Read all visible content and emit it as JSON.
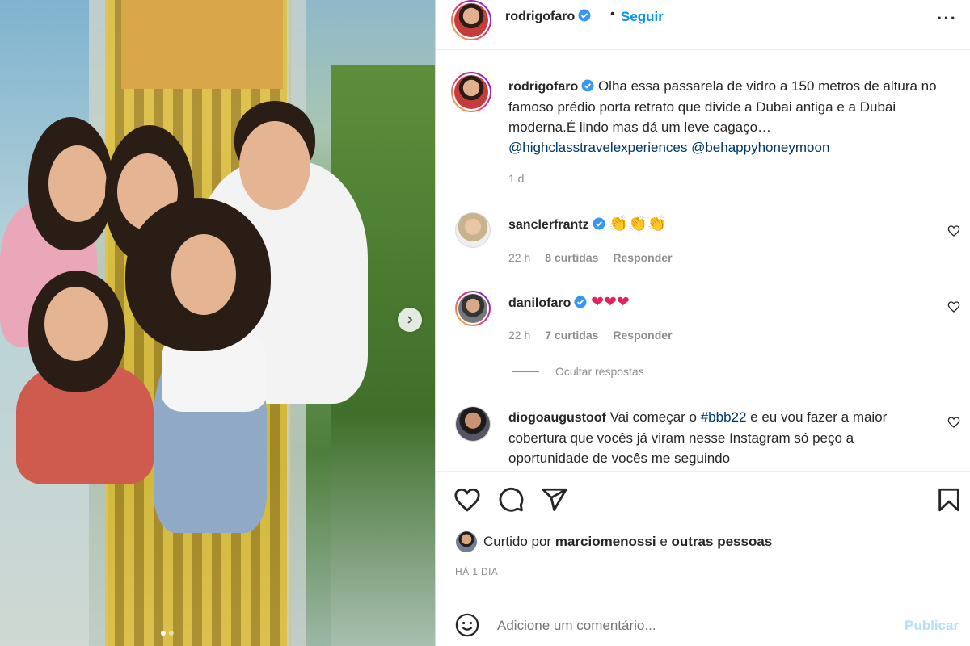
{
  "post": {
    "author": "rodrigofaro",
    "follow_label": "Seguir",
    "separator": "•",
    "more_label": "···",
    "photo_alt": "Foto da família na passarela de vidro",
    "carousel": {
      "current": 1,
      "total": 2
    }
  },
  "caption": {
    "author": "rodrigofaro",
    "text": "Olha essa passarela de vidro a 150 metros de altura no famoso prédio porta retrato que divide a Dubai antiga e a Dubai moderna.É lindo mas dá um leve cagaço…",
    "mentions": "@highclasstravelexperiences @behappyhoneymoon",
    "time": "1 d"
  },
  "comments": [
    {
      "author": "sanclerfrantz",
      "verified": true,
      "text": "👏👏👏",
      "time": "22 h",
      "likes": "8 curtidas",
      "reply": "Responder"
    },
    {
      "author": "danilofaro",
      "verified": true,
      "text": "❤❤❤",
      "time": "22 h",
      "likes": "7 curtidas",
      "reply": "Responder"
    },
    {
      "author": "diogoaugustoof",
      "verified": false,
      "text_pre": "Vai começar o ",
      "hashtag": "#bbb22",
      "text_post": "  e eu vou fazer a maior cobertura que vocês já viram nesse Instagram só peço a oportunidade de vocês me seguindo"
    }
  ],
  "hide_replies": "Ocultar respostas",
  "likes": {
    "prefix": "Curtido por",
    "user": "marciomenossi",
    "conj": "e",
    "others": "outras pessoas"
  },
  "posted_ago": "HÁ 1 DIA",
  "add_comment": {
    "placeholder": "Adicione um comentário...",
    "publish": "Publicar"
  },
  "colors": {
    "link": "#0095f6",
    "mention": "#00376b",
    "muted": "#8e8e8e",
    "verified": "#3897f0"
  },
  "icons": [
    "verified-icon",
    "more-icon",
    "heart-icon",
    "comment-icon",
    "share-icon",
    "bookmark-icon",
    "emoji-icon",
    "chevron-right-icon"
  ]
}
